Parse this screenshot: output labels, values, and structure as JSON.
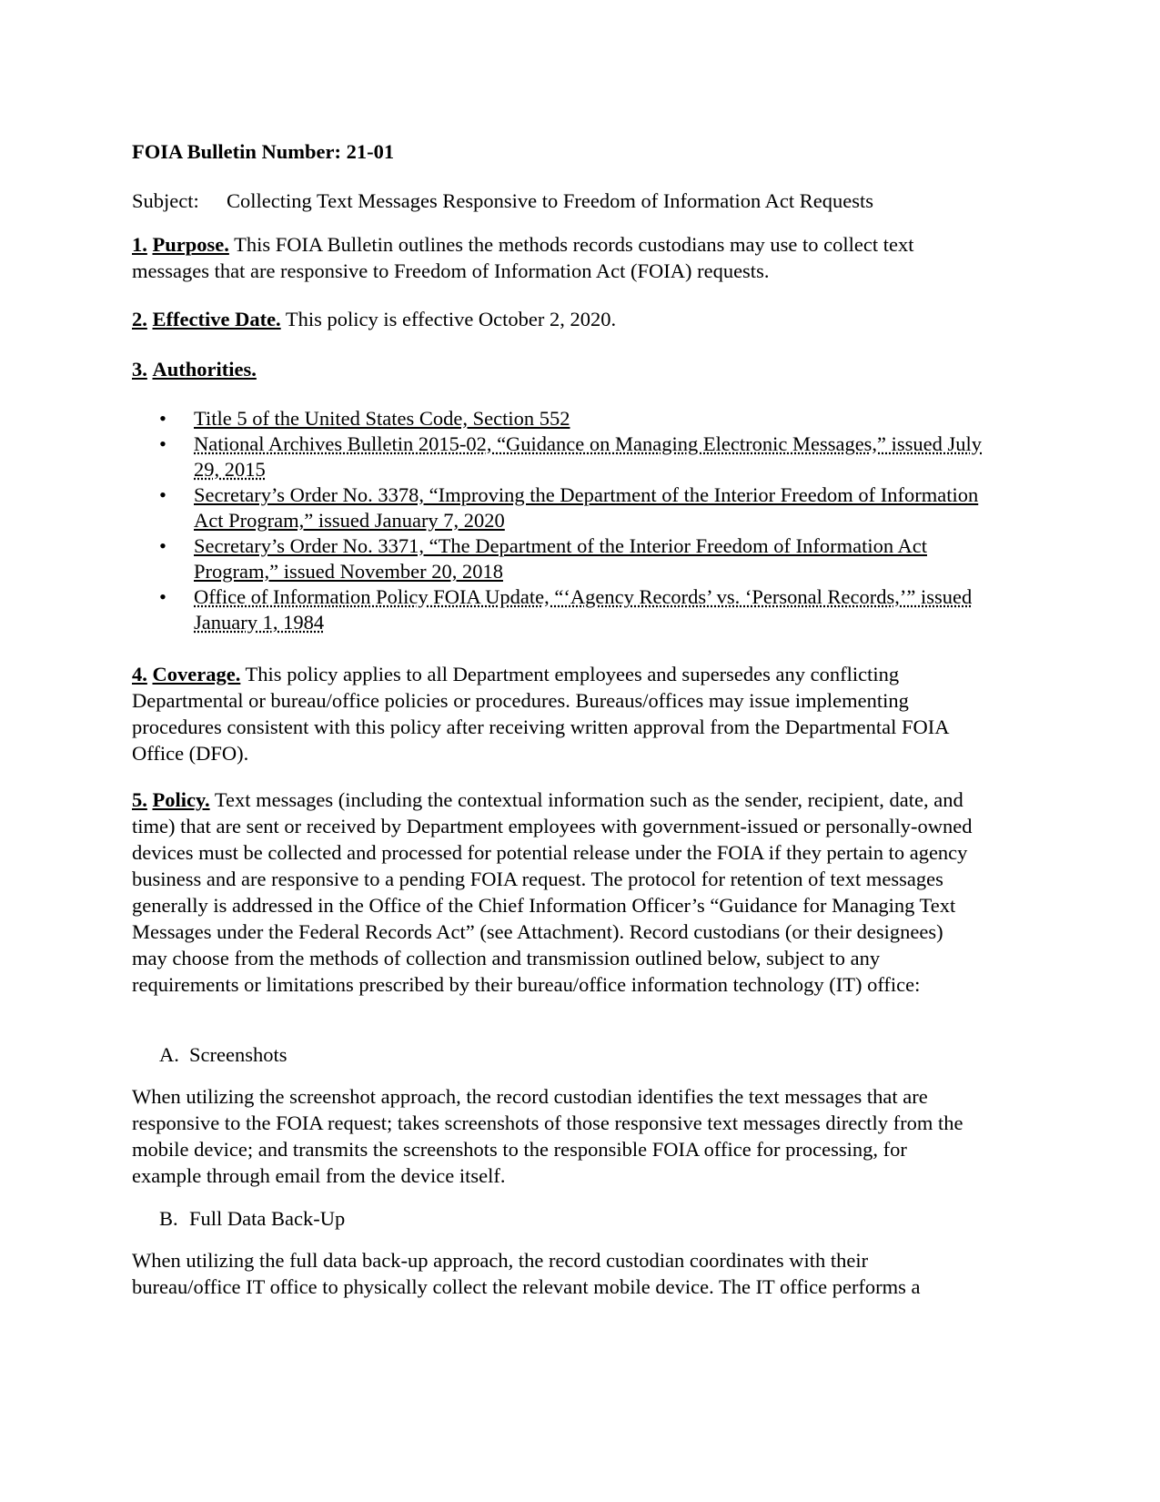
{
  "document": {
    "title": "FOIA Bulletin Number:  21-01",
    "subject_label": "Subject:",
    "subject_text": "Collecting Text Messages Responsive to Freedom of Information Act Requests",
    "sections": {
      "purpose": {
        "number": "1.",
        "heading": "Purpose.",
        "text": " This FOIA Bulletin outlines the methods records custodians may use to collect text messages that are responsive to Freedom of Information Act (FOIA) requests."
      },
      "effective_date": {
        "number": "2.",
        "heading": "Effective Date.",
        "text": " This policy is effective October 2, 2020."
      },
      "authorities": {
        "number": "3.",
        "heading": "Authorities.",
        "items": [
          "Title 5 of the United States Code, Section 552",
          "National Archives Bulletin 2015-02, “Guidance on Managing Electronic Messages,” issued July 29, 2015",
          "Secretary’s Order No. 3378, “Improving the Department of the Interior Freedom of Information Act Program,” issued January 7, 2020",
          "Secretary’s Order No. 3371, “The Department of the Interior Freedom of Information Act Program,” issued November 20, 2018",
          "Office of Information Policy FOIA Update, “‘Agency Records’ vs. ‘Personal Records,’” issued January 1, 1984"
        ]
      },
      "coverage": {
        "number": "4.",
        "heading": "Coverage.",
        "text": " This policy applies to all Department employees and supersedes any conflicting Departmental or bureau/office policies or procedures.  Bureaus/offices may issue implementing procedures consistent with this policy after receiving written approval from the Departmental FOIA Office (DFO)."
      },
      "policy": {
        "number": "5.",
        "heading": "Policy.",
        "text": " Text messages (including the contextual information such as the sender, recipient, date, and time) that are sent or received by Department employees with government-issued or personally-owned devices must be collected and processed for potential release under the FOIA if they pertain to agency business and are responsive to a pending FOIA request.  The protocol for retention of text messages generally is addressed in the Office of the Chief Information Officer’s “Guidance for Managing Text Messages under the Federal Records Act” (see Attachment).  Record custodians (or their designees) may choose from the methods of collection and transmission outlined below, subject to any requirements or limitations prescribed by their bureau/office information technology (IT) office:"
      },
      "method_a": {
        "letter": "A.",
        "label": "Screenshots",
        "text": "When utilizing the screenshot approach, the record custodian identifies the text messages that are responsive to the FOIA request; takes screenshots of those responsive text messages directly from the mobile device; and transmits the screenshots to the responsible FOIA office for processing, for example through email from the device itself."
      },
      "method_b": {
        "letter": "B.",
        "label": "Full Data Back-Up",
        "text": "When utilizing the full data back-up approach, the record custodian coordinates with their bureau/office IT office to physically collect the relevant mobile device.  The IT office performs a"
      }
    }
  }
}
